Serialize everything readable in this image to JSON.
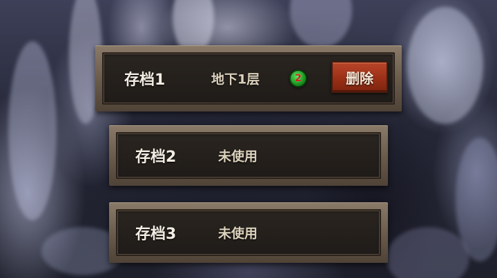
{
  "slots": [
    {
      "name": "存档1",
      "status": "地下1层",
      "level": "2",
      "delete_label": "删除",
      "active": true
    },
    {
      "name": "存档2",
      "status": "未使用"
    },
    {
      "name": "存档3",
      "status": "未使用"
    }
  ],
  "colors": {
    "panel_frame": "#6b5c4c",
    "panel_inner": "#211d19",
    "slot_name_text": "#f2ece2",
    "status_text": "#dcd2bd",
    "badge_green": "#1f9a24",
    "badge_number": "#d41f1f",
    "delete_button": "#9a3016"
  }
}
